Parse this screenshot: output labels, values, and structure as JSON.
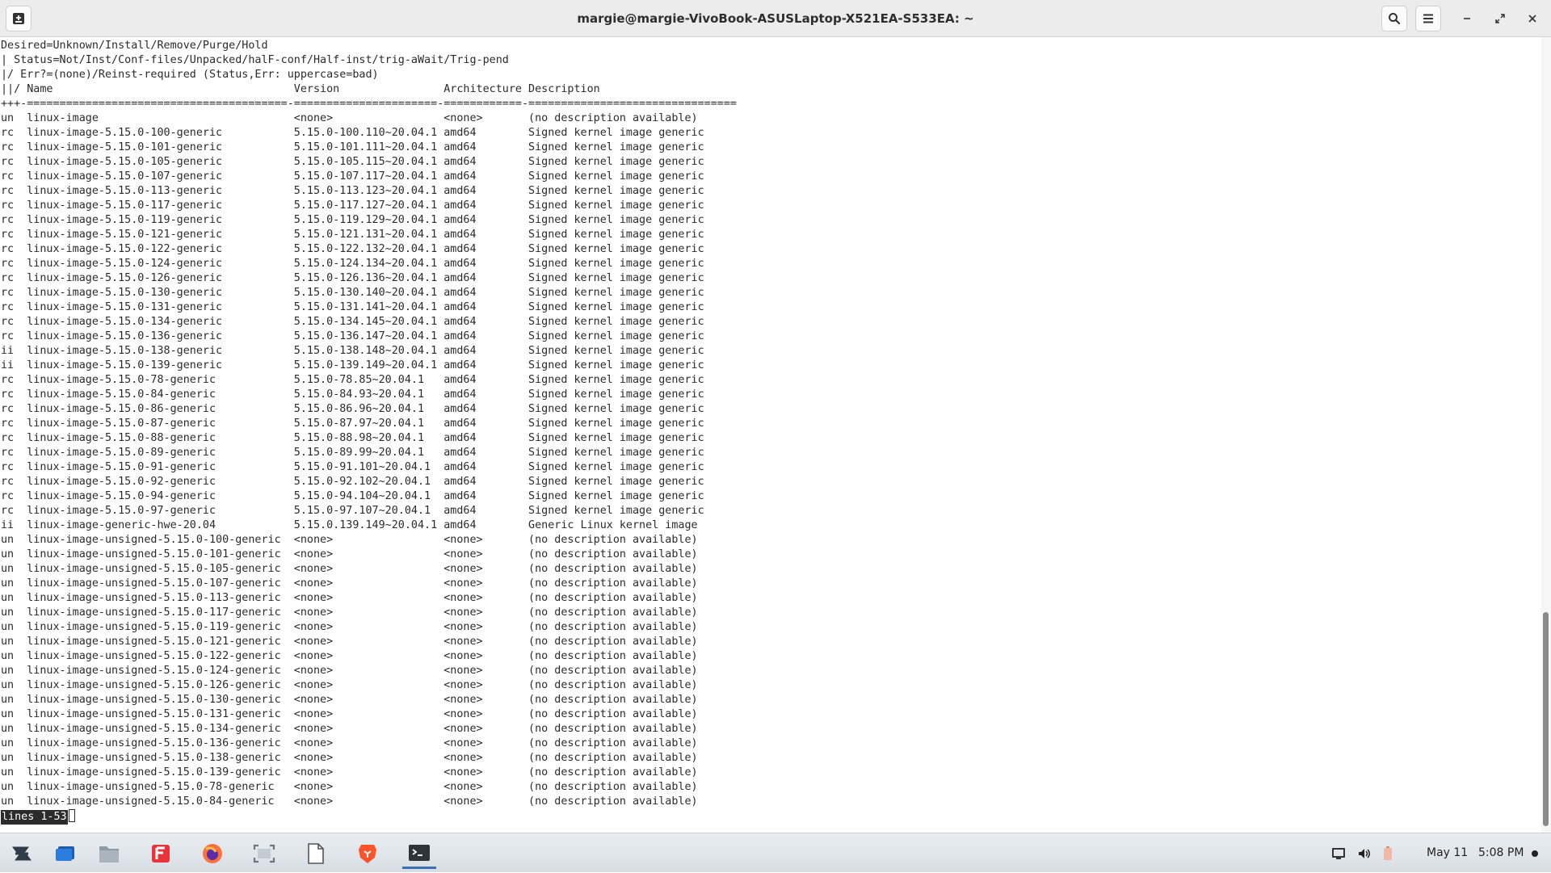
{
  "window": {
    "title": "margie@margie-VivoBook-ASUSLaptop-X521EA-S533EA: ~",
    "icons": {
      "new_tab": "new-tab-icon",
      "search": "search-icon",
      "menu": "hamburger-menu-icon",
      "minimize": "minimize-icon",
      "maximize": "restore-icon",
      "close": "close-icon"
    }
  },
  "terminal": {
    "lines": [
      "Desired=Unknown/Install/Remove/Purge/Hold",
      "| Status=Not/Inst/Conf-files/Unpacked/halF-conf/Half-inst/trig-aWait/Trig-pend",
      "|/ Err?=(none)/Reinst-required (Status,Err: uppercase=bad)",
      "||/ Name                                     Version                Architecture Description",
      "+++-========================================-======================-============-================================",
      "un  linux-image                              <none>                 <none>       (no description available)",
      "rc  linux-image-5.15.0-100-generic           5.15.0-100.110~20.04.1 amd64        Signed kernel image generic",
      "rc  linux-image-5.15.0-101-generic           5.15.0-101.111~20.04.1 amd64        Signed kernel image generic",
      "rc  linux-image-5.15.0-105-generic           5.15.0-105.115~20.04.1 amd64        Signed kernel image generic",
      "rc  linux-image-5.15.0-107-generic           5.15.0-107.117~20.04.1 amd64        Signed kernel image generic",
      "rc  linux-image-5.15.0-113-generic           5.15.0-113.123~20.04.1 amd64        Signed kernel image generic",
      "rc  linux-image-5.15.0-117-generic           5.15.0-117.127~20.04.1 amd64        Signed kernel image generic",
      "rc  linux-image-5.15.0-119-generic           5.15.0-119.129~20.04.1 amd64        Signed kernel image generic",
      "rc  linux-image-5.15.0-121-generic           5.15.0-121.131~20.04.1 amd64        Signed kernel image generic",
      "rc  linux-image-5.15.0-122-generic           5.15.0-122.132~20.04.1 amd64        Signed kernel image generic",
      "rc  linux-image-5.15.0-124-generic           5.15.0-124.134~20.04.1 amd64        Signed kernel image generic",
      "rc  linux-image-5.15.0-126-generic           5.15.0-126.136~20.04.1 amd64        Signed kernel image generic",
      "rc  linux-image-5.15.0-130-generic           5.15.0-130.140~20.04.1 amd64        Signed kernel image generic",
      "rc  linux-image-5.15.0-131-generic           5.15.0-131.141~20.04.1 amd64        Signed kernel image generic",
      "rc  linux-image-5.15.0-134-generic           5.15.0-134.145~20.04.1 amd64        Signed kernel image generic",
      "rc  linux-image-5.15.0-136-generic           5.15.0-136.147~20.04.1 amd64        Signed kernel image generic",
      "ii  linux-image-5.15.0-138-generic           5.15.0-138.148~20.04.1 amd64        Signed kernel image generic",
      "ii  linux-image-5.15.0-139-generic           5.15.0-139.149~20.04.1 amd64        Signed kernel image generic",
      "rc  linux-image-5.15.0-78-generic            5.15.0-78.85~20.04.1   amd64        Signed kernel image generic",
      "rc  linux-image-5.15.0-84-generic            5.15.0-84.93~20.04.1   amd64        Signed kernel image generic",
      "rc  linux-image-5.15.0-86-generic            5.15.0-86.96~20.04.1   amd64        Signed kernel image generic",
      "rc  linux-image-5.15.0-87-generic            5.15.0-87.97~20.04.1   amd64        Signed kernel image generic",
      "rc  linux-image-5.15.0-88-generic            5.15.0-88.98~20.04.1   amd64        Signed kernel image generic",
      "rc  linux-image-5.15.0-89-generic            5.15.0-89.99~20.04.1   amd64        Signed kernel image generic",
      "rc  linux-image-5.15.0-91-generic            5.15.0-91.101~20.04.1  amd64        Signed kernel image generic",
      "rc  linux-image-5.15.0-92-generic            5.15.0-92.102~20.04.1  amd64        Signed kernel image generic",
      "rc  linux-image-5.15.0-94-generic            5.15.0-94.104~20.04.1  amd64        Signed kernel image generic",
      "rc  linux-image-5.15.0-97-generic            5.15.0-97.107~20.04.1  amd64        Signed kernel image generic",
      "ii  linux-image-generic-hwe-20.04            5.15.0.139.149~20.04.1 amd64        Generic Linux kernel image",
      "un  linux-image-unsigned-5.15.0-100-generic  <none>                 <none>       (no description available)",
      "un  linux-image-unsigned-5.15.0-101-generic  <none>                 <none>       (no description available)",
      "un  linux-image-unsigned-5.15.0-105-generic  <none>                 <none>       (no description available)",
      "un  linux-image-unsigned-5.15.0-107-generic  <none>                 <none>       (no description available)",
      "un  linux-image-unsigned-5.15.0-113-generic  <none>                 <none>       (no description available)",
      "un  linux-image-unsigned-5.15.0-117-generic  <none>                 <none>       (no description available)",
      "un  linux-image-unsigned-5.15.0-119-generic  <none>                 <none>       (no description available)",
      "un  linux-image-unsigned-5.15.0-121-generic  <none>                 <none>       (no description available)",
      "un  linux-image-unsigned-5.15.0-122-generic  <none>                 <none>       (no description available)",
      "un  linux-image-unsigned-5.15.0-124-generic  <none>                 <none>       (no description available)",
      "un  linux-image-unsigned-5.15.0-126-generic  <none>                 <none>       (no description available)",
      "un  linux-image-unsigned-5.15.0-130-generic  <none>                 <none>       (no description available)",
      "un  linux-image-unsigned-5.15.0-131-generic  <none>                 <none>       (no description available)",
      "un  linux-image-unsigned-5.15.0-134-generic  <none>                 <none>       (no description available)",
      "un  linux-image-unsigned-5.15.0-136-generic  <none>                 <none>       (no description available)",
      "un  linux-image-unsigned-5.15.0-138-generic  <none>                 <none>       (no description available)",
      "un  linux-image-unsigned-5.15.0-139-generic  <none>                 <none>       (no description available)",
      "un  linux-image-unsigned-5.15.0-78-generic   <none>                 <none>       (no description available)",
      "un  linux-image-unsigned-5.15.0-84-generic   <none>                 <none>       (no description available)"
    ],
    "pager_prompt": "lines 1-53"
  },
  "taskbar": {
    "apps": [
      {
        "name": "zorin-menu-icon",
        "active": false
      },
      {
        "name": "workspaces-icon",
        "active": false
      },
      {
        "name": "files-icon",
        "active": false
      },
      {
        "name": "flathub-store-icon",
        "active": false
      },
      {
        "name": "firefox-icon",
        "active": false
      },
      {
        "name": "screenshot-icon",
        "active": false
      },
      {
        "name": "text-editor-icon",
        "active": false
      },
      {
        "name": "brave-browser-icon",
        "active": false
      },
      {
        "name": "terminal-icon",
        "active": true
      }
    ],
    "tray_icons": [
      "display-icon",
      "volume-icon",
      "battery-icon"
    ],
    "date": "May 11",
    "time": "5:08 PM",
    "colors": {
      "active_indicator": "#3c6fb0",
      "brave": "#fb542b",
      "firefox": "#ff7139"
    }
  }
}
